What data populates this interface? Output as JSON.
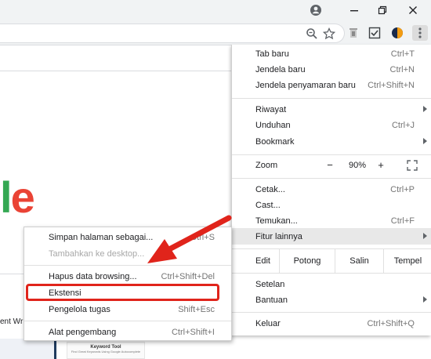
{
  "browser": {
    "zoom_level": "90%",
    "colors": {
      "accent_red": "#e0241b",
      "google_green": "#34a853",
      "google_red": "#ea4335"
    }
  },
  "page": {
    "logo_fragment_l": "l",
    "logo_fragment_e": "e",
    "bottom_left_text": "ent Wr",
    "thumbnail_title": "Keyword Tool",
    "thumbnail_subtitle": "Find Great Keywords Using Google Autocomplete"
  },
  "menu": {
    "new_tab": {
      "label": "Tab baru",
      "shortcut": "Ctrl+T"
    },
    "new_window": {
      "label": "Jendela baru",
      "shortcut": "Ctrl+N"
    },
    "incognito": {
      "label": "Jendela penyamaran baru",
      "shortcut": "Ctrl+Shift+N"
    },
    "history": {
      "label": "Riwayat"
    },
    "downloads": {
      "label": "Unduhan",
      "shortcut": "Ctrl+J"
    },
    "bookmarks": {
      "label": "Bookmark"
    },
    "zoom": {
      "label": "Zoom",
      "minus": "−",
      "value": "90%",
      "plus": "+"
    },
    "print": {
      "label": "Cetak...",
      "shortcut": "Ctrl+P"
    },
    "cast": {
      "label": "Cast..."
    },
    "find": {
      "label": "Temukan...",
      "shortcut": "Ctrl+F"
    },
    "more_tools": {
      "label": "Fitur lainnya"
    },
    "edit": {
      "label": "Edit",
      "cut": "Potong",
      "copy": "Salin",
      "paste": "Tempel"
    },
    "settings": {
      "label": "Setelan"
    },
    "help": {
      "label": "Bantuan"
    },
    "exit": {
      "label": "Keluar",
      "shortcut": "Ctrl+Shift+Q"
    }
  },
  "submenu": {
    "save_page": {
      "label": "Simpan halaman sebagai...",
      "shortcut": "Ctrl+S"
    },
    "add_desktop": {
      "label": "Tambahkan ke desktop..."
    },
    "clear_data": {
      "label": "Hapus data browsing...",
      "shortcut": "Ctrl+Shift+Del"
    },
    "extensions": {
      "label": "Ekstensi"
    },
    "task_manager": {
      "label": "Pengelola tugas",
      "shortcut": "Shift+Esc"
    },
    "dev_tools": {
      "label": "Alat pengembang",
      "shortcut": "Ctrl+Shift+I"
    }
  },
  "icons": {
    "profile": "account-circle-icon",
    "minimize": "minimize-icon",
    "restore": "restore-icon",
    "close": "close-icon",
    "zoom_lens": "zoom-lens-icon",
    "star": "bookmark-star-icon",
    "ext1": "extension-trash-icon",
    "ext2": "extension-screenshot-icon",
    "ext3": "extension-round-icon",
    "menu": "kebab-menu-icon",
    "fullscreen": "fullscreen-icon"
  }
}
